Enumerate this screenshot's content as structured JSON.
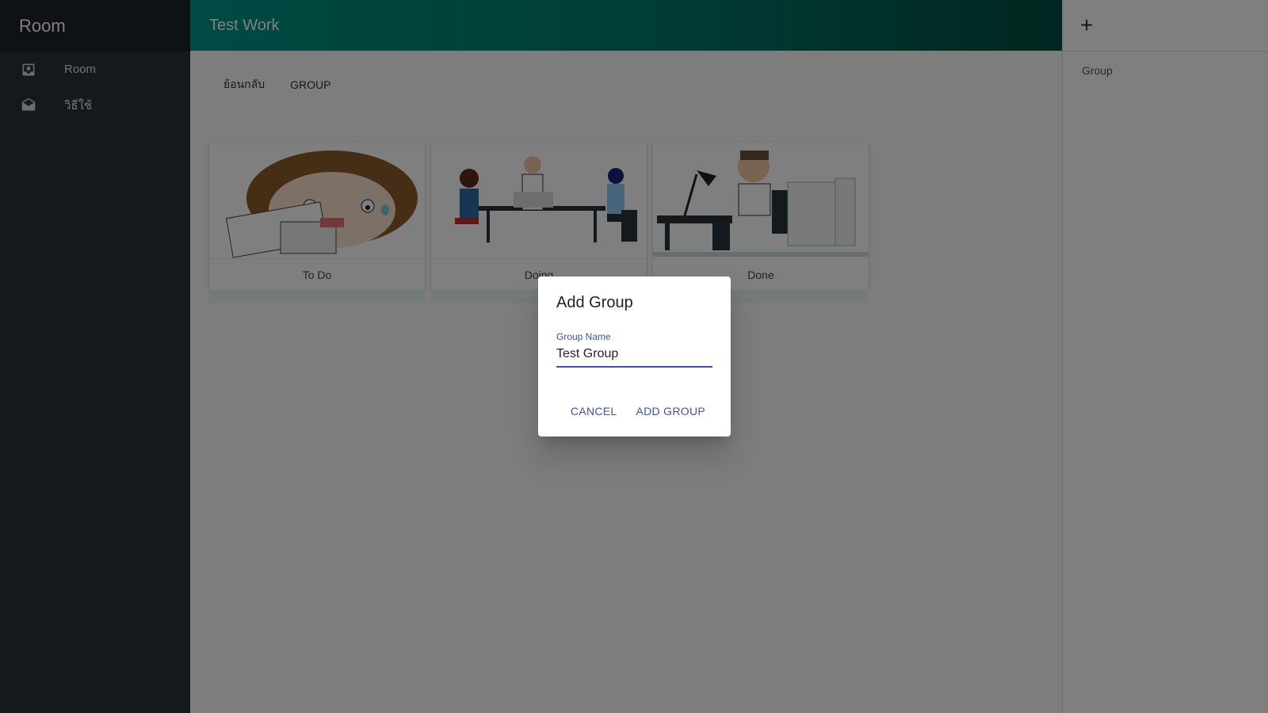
{
  "sidebar": {
    "title": "Room",
    "items": [
      {
        "label": "Room",
        "icon": "inbox-icon"
      },
      {
        "label": "วิธีใช้",
        "icon": "drafts-icon"
      }
    ]
  },
  "appbar": {
    "title": "Test Work"
  },
  "tabs": [
    {
      "label": "ย้อนกลับ"
    },
    {
      "label": "GROUP"
    }
  ],
  "cards": [
    {
      "label": "To Do"
    },
    {
      "label": "Doing"
    },
    {
      "label": "Done"
    }
  ],
  "rightpanel": {
    "add_icon": "plus-icon",
    "plus": "+",
    "item_label": "Group"
  },
  "dialog": {
    "title": "Add Group",
    "field_label": "Group Name",
    "field_value": "Test Group",
    "cancel_label": "CANCEL",
    "submit_label": "ADD GROUP"
  },
  "colors": {
    "appbar_start": "#009688",
    "appbar_end": "#004d40",
    "sidebar": "#263238",
    "accent": "#3f51b5"
  }
}
